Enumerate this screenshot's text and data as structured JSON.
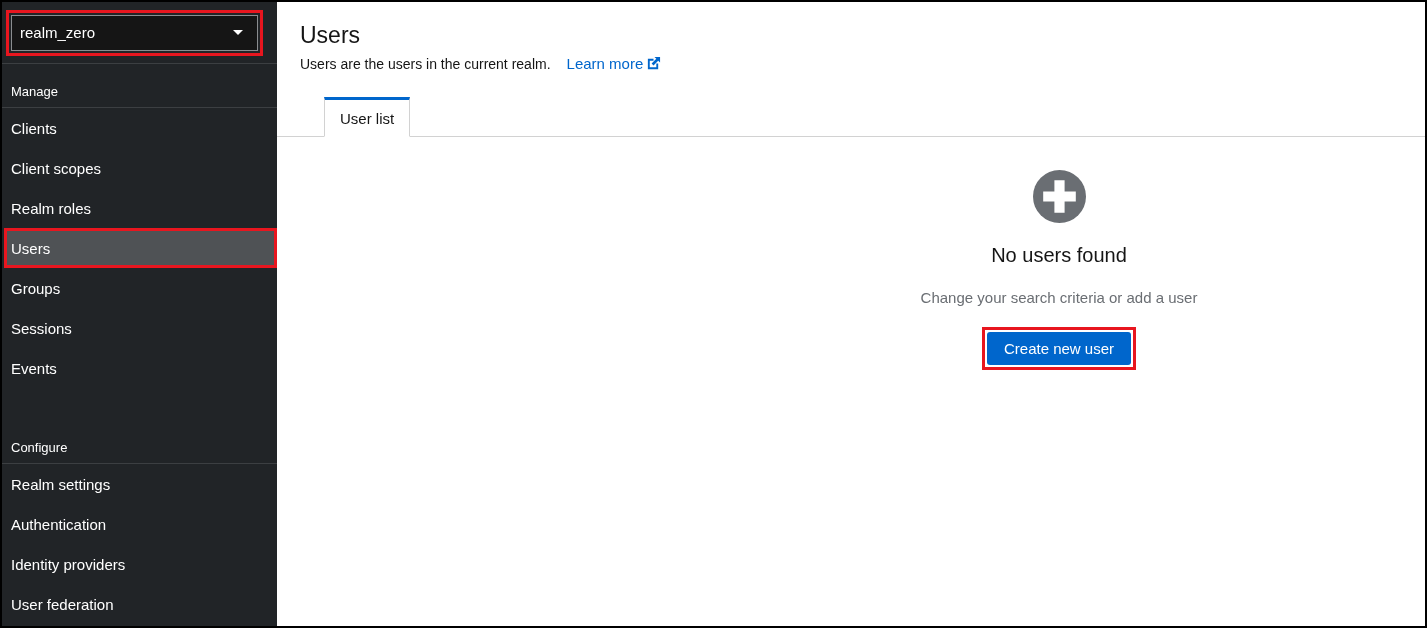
{
  "realm_selector": {
    "value": "realm_zero",
    "highlighted": true
  },
  "sidebar": {
    "sections": [
      {
        "title": "Manage",
        "items": [
          {
            "label": "Clients",
            "selected": false,
            "highlighted": false
          },
          {
            "label": "Client scopes",
            "selected": false,
            "highlighted": false
          },
          {
            "label": "Realm roles",
            "selected": false,
            "highlighted": false
          },
          {
            "label": "Users",
            "selected": true,
            "highlighted": true
          },
          {
            "label": "Groups",
            "selected": false,
            "highlighted": false
          },
          {
            "label": "Sessions",
            "selected": false,
            "highlighted": false
          },
          {
            "label": "Events",
            "selected": false,
            "highlighted": false
          }
        ]
      },
      {
        "title": "Configure",
        "items": [
          {
            "label": "Realm settings",
            "selected": false,
            "highlighted": false
          },
          {
            "label": "Authentication",
            "selected": false,
            "highlighted": false
          },
          {
            "label": "Identity providers",
            "selected": false,
            "highlighted": false
          },
          {
            "label": "User federation",
            "selected": false,
            "highlighted": false
          }
        ]
      }
    ]
  },
  "page": {
    "title": "Users",
    "description": "Users are the users in the current realm.",
    "link": "Learn more"
  },
  "tabs": [
    {
      "label": "User list",
      "selected": true
    }
  ],
  "empty_state": {
    "title": "No users found",
    "message": "Change your search criteria or add a user",
    "button": {
      "label": "Create new user",
      "highlighted": true
    }
  }
}
